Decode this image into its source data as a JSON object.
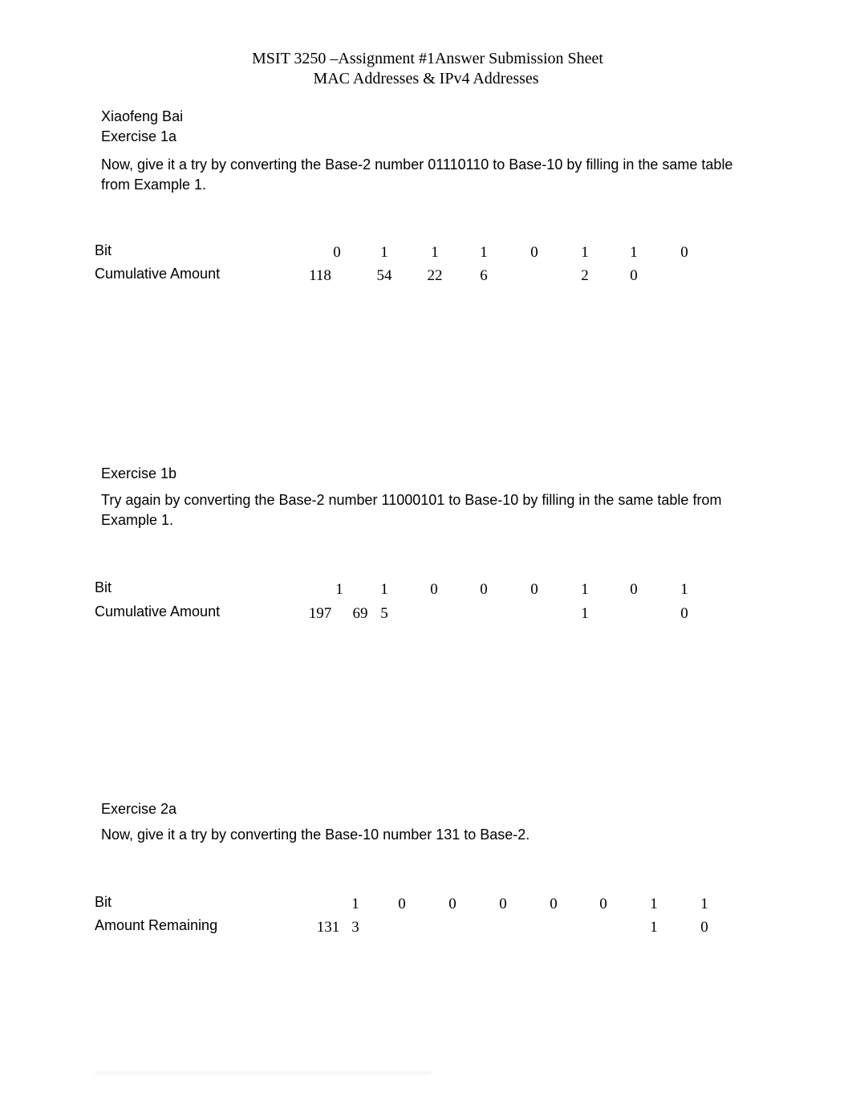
{
  "header": {
    "title_line1": "MSIT 3250 –Assignment #1Answer Submission Sheet",
    "title_line2": "MAC Addresses & IPv4 Addresses"
  },
  "student_name": "Xiaofeng Bai",
  "exercises": [
    {
      "heading": "Exercise 1a",
      "prompt": "Now, give it a try by converting the Base-2 number 01110110 to Base-10 by filling in the same table from Example 1.",
      "row1_label": "Bit",
      "row2_label": "Cumulative Amount",
      "start_value": "118",
      "bits": [
        "0",
        "1",
        "1",
        "1",
        "0",
        "1",
        "1",
        "0"
      ],
      "amounts": [
        "",
        "54",
        "22",
        "6",
        "",
        "2",
        "0",
        ""
      ]
    },
    {
      "heading": "Exercise 1b",
      "prompt": "Try again by converting the Base-2 number 11000101 to Base-10 by filling in the same table from Example 1.",
      "row1_label": "Bit",
      "row2_label": "Cumulative Amount",
      "start_value": "197",
      "bits": [
        "1",
        "1",
        "0",
        "0",
        "0",
        "1",
        "0",
        "1"
      ],
      "amounts": [
        "69",
        "5",
        "",
        "",
        "",
        "1",
        "",
        "0"
      ]
    },
    {
      "heading": "Exercise 2a",
      "prompt": "Now, give it a try by converting the Base-10 number 131 to Base-2.",
      "row1_label": "Bit",
      "row2_label": "Amount Remaining",
      "start_value": "131",
      "bits": [
        "1",
        "0",
        "0",
        "0",
        "0",
        "0",
        "1",
        "1"
      ],
      "amounts": [
        "3",
        "",
        "",
        "",
        "",
        "",
        "1",
        "0"
      ]
    }
  ]
}
